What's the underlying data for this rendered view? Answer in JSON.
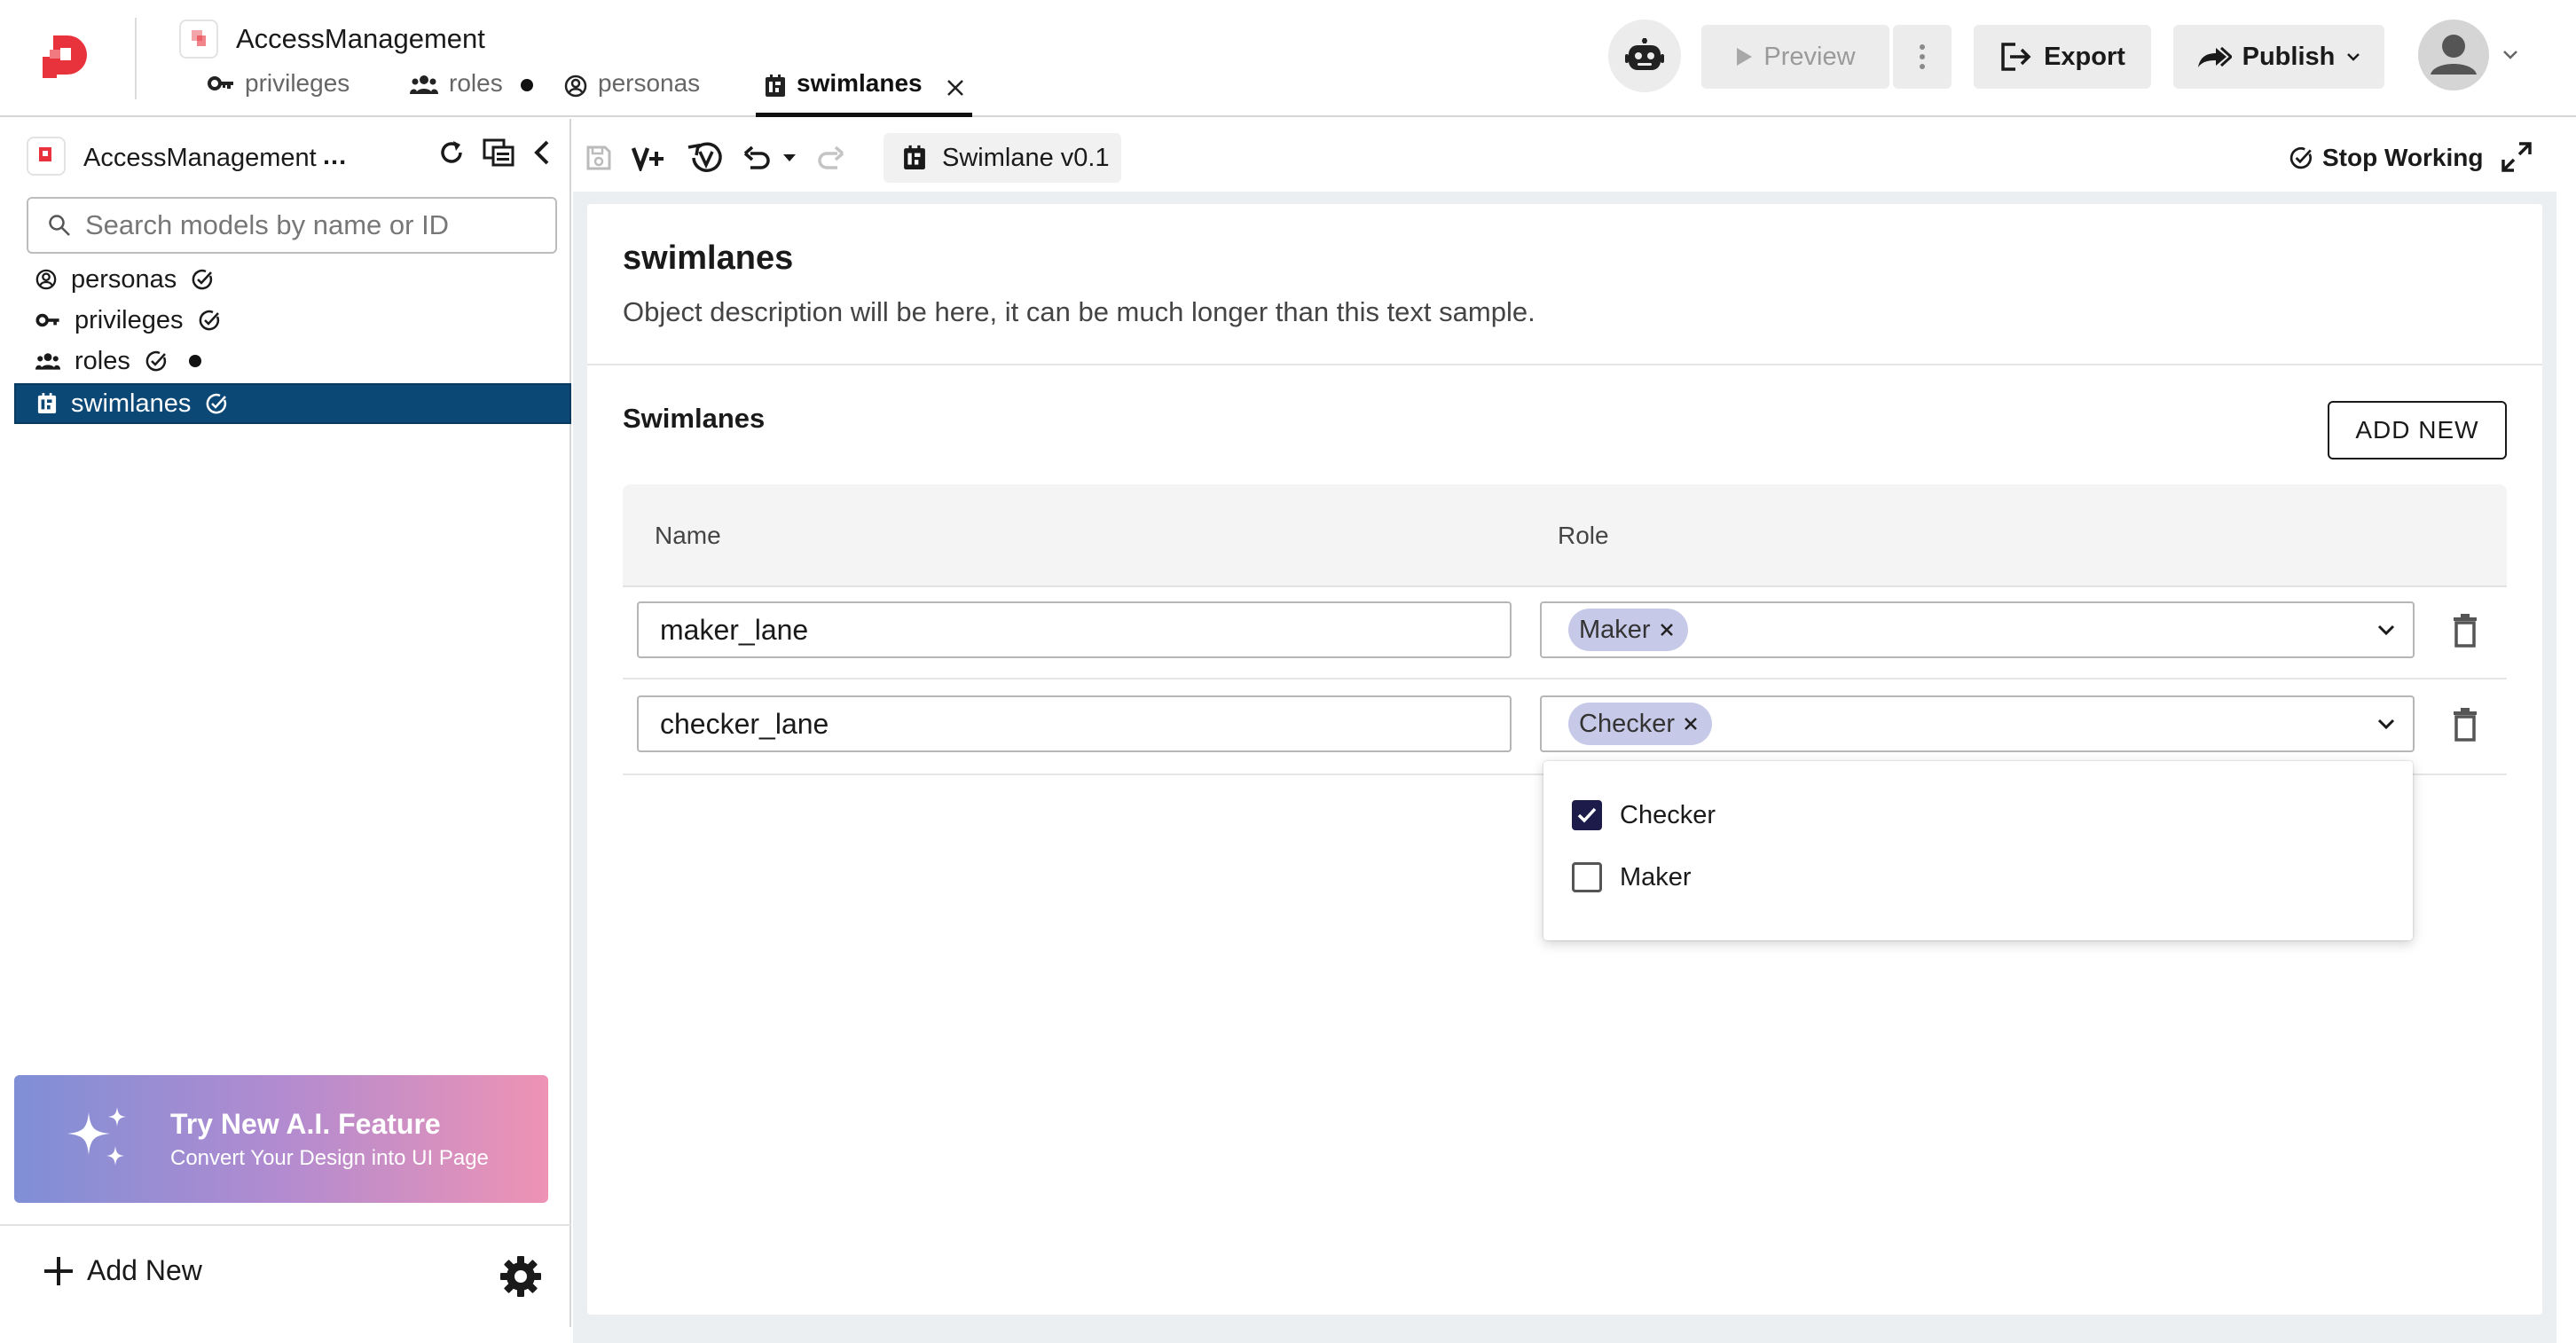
{
  "header": {
    "app_title": "AccessManagement",
    "tabs": [
      {
        "label": "privileges",
        "icon": "key-icon",
        "modified": false
      },
      {
        "label": "roles",
        "icon": "users-icon",
        "modified": true
      },
      {
        "label": "personas",
        "icon": "person-circle-icon",
        "modified": false
      },
      {
        "label": "swimlanes",
        "icon": "swimlane-icon",
        "active": true,
        "closable": true
      }
    ],
    "preview_label": "Preview",
    "export_label": "Export",
    "publish_label": "Publish"
  },
  "sidebar": {
    "app_title": "AccessManagement",
    "app_menu": "...",
    "search_placeholder": "Search models by name or ID",
    "items": [
      {
        "label": "personas",
        "icon": "person-circle-icon",
        "status": "check",
        "modified": false
      },
      {
        "label": "privileges",
        "icon": "key-icon",
        "status": "check",
        "modified": false
      },
      {
        "label": "roles",
        "icon": "users-icon",
        "status": "check",
        "modified": true
      },
      {
        "label": "swimlanes",
        "icon": "swimlane-icon",
        "status": "check",
        "selected": true
      }
    ],
    "ai_banner": {
      "title": "Try New A.I. Feature",
      "subtitle": "Convert Your Design into UI Page"
    },
    "add_new_label": "Add New"
  },
  "toolbar": {
    "version_label": "Swimlane v0.1",
    "stop_working_label": "Stop Working"
  },
  "main": {
    "object_title": "swimlanes",
    "object_description": "Object description will be here, it can be much longer than this text sample.",
    "section_title": "Swimlanes",
    "add_new_button": "ADD NEW",
    "table": {
      "columns": [
        "Name",
        "Role"
      ],
      "rows": [
        {
          "name": "maker_lane",
          "roles": [
            "Maker"
          ]
        },
        {
          "name": "checker_lane",
          "roles": [
            "Checker"
          ]
        }
      ]
    },
    "role_dropdown": {
      "options": [
        {
          "label": "Checker",
          "checked": true
        },
        {
          "label": "Maker",
          "checked": false
        }
      ]
    }
  },
  "colors": {
    "selected_item_bg": "#0c4876",
    "chip_bg": "#c7c9e8",
    "checkbox_checked": "#1c1b4a",
    "brand_red": "#e8323c"
  }
}
